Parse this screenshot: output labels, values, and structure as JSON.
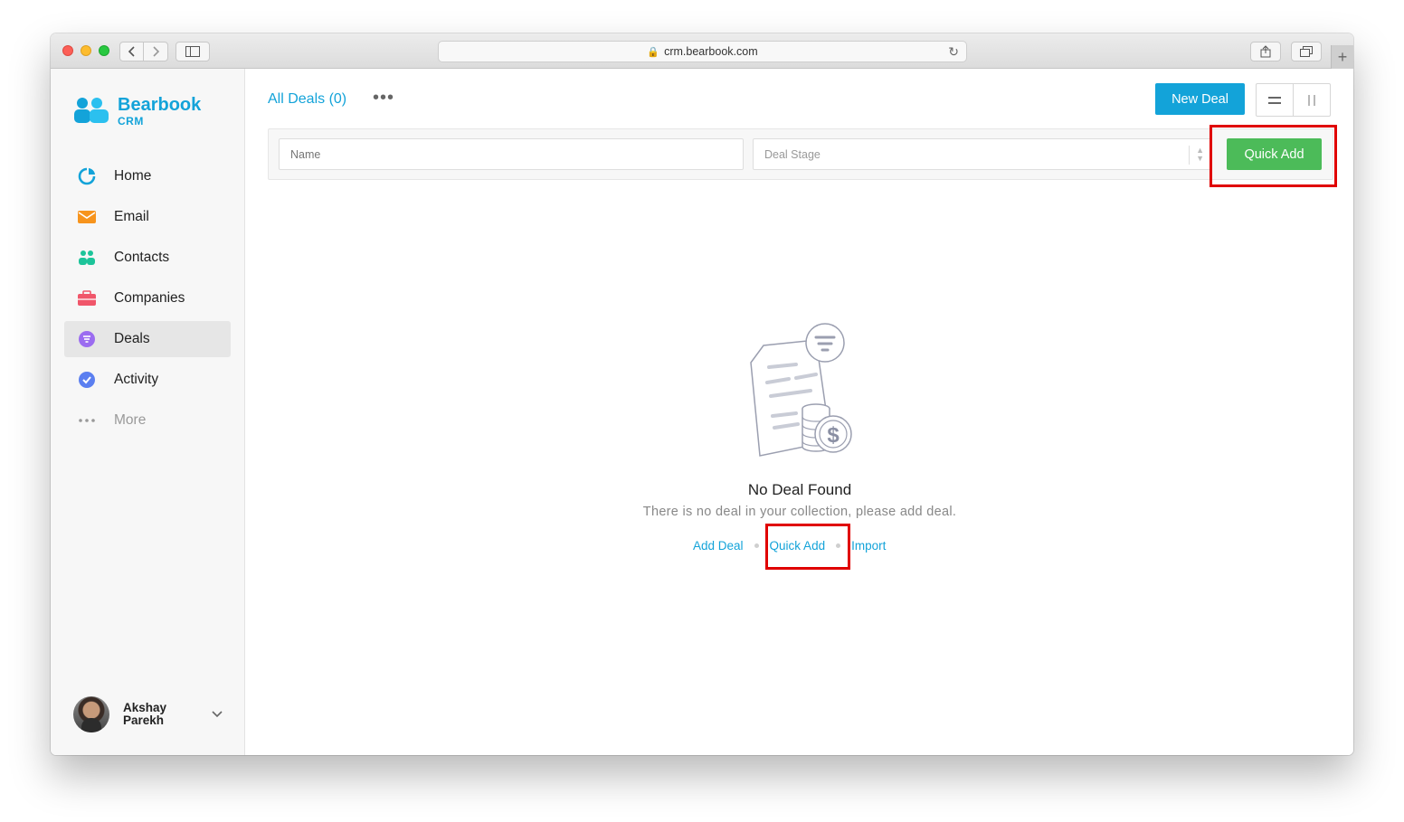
{
  "browser": {
    "url": "crm.bearbook.com"
  },
  "brand": {
    "name": "Bearbook",
    "sub": "CRM",
    "accent": "#13a3d9"
  },
  "sidebar": {
    "items": [
      {
        "label": "Home",
        "icon": "pie-chart-icon"
      },
      {
        "label": "Email",
        "icon": "envelope-icon"
      },
      {
        "label": "Contacts",
        "icon": "contacts-icon"
      },
      {
        "label": "Companies",
        "icon": "briefcase-icon"
      },
      {
        "label": "Deals",
        "icon": "deals-icon",
        "active": true
      },
      {
        "label": "Activity",
        "icon": "check-circle-icon"
      },
      {
        "label": "More",
        "icon": "more-dots-icon"
      }
    ],
    "user": {
      "name": "Akshay Parekh"
    }
  },
  "main": {
    "view_title": "All Deals (0)",
    "new_deal_label": "New Deal",
    "filters": {
      "name_placeholder": "Name",
      "stage_placeholder": "Deal Stage",
      "quick_add_label": "Quick Add"
    },
    "empty": {
      "title": "No Deal Found",
      "subtitle": "There is no deal in your collection, please add deal.",
      "actions": [
        "Add Deal",
        "Quick Add",
        "Import"
      ]
    }
  },
  "colors": {
    "primary": "#13a3d9",
    "quick_add_green": "#4cbb59",
    "highlight_red": "#e00000"
  }
}
